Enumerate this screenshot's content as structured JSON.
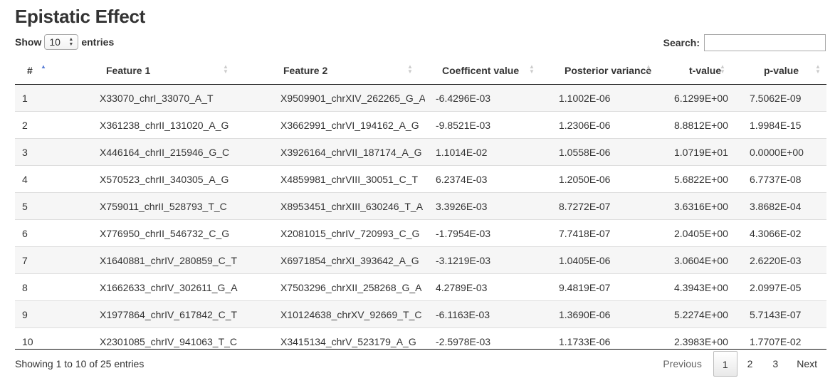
{
  "title": "Epistatic Effect",
  "length": {
    "show_label": "Show",
    "value": "10",
    "entries_label": "entries"
  },
  "search": {
    "label": "Search:",
    "value": ""
  },
  "columns": [
    "#",
    "Feature 1",
    "Feature 2",
    "Coefficent value",
    "Posterior variance",
    "t-value",
    "p-value"
  ],
  "sort": {
    "column": "#",
    "direction": "ascending"
  },
  "rows": [
    [
      "1",
      "X33070_chrI_33070_A_T",
      "X9509901_chrXIV_262265_G_A",
      "-6.4296E-03",
      "1.1002E-06",
      "6.1299E+00",
      "7.5062E-09"
    ],
    [
      "2",
      "X361238_chrII_131020_A_G",
      "X3662991_chrVI_194162_A_G",
      "-9.8521E-03",
      "1.2306E-06",
      "8.8812E+00",
      "1.9984E-15"
    ],
    [
      "3",
      "X446164_chrII_215946_G_C",
      "X3926164_chrVII_187174_A_G",
      "1.1014E-02",
      "1.0558E-06",
      "1.0719E+01",
      "0.0000E+00"
    ],
    [
      "4",
      "X570523_chrII_340305_A_G",
      "X4859981_chrVIII_30051_C_T",
      "6.2374E-03",
      "1.2050E-06",
      "5.6822E+00",
      "6.7737E-08"
    ],
    [
      "5",
      "X759011_chrII_528793_T_C",
      "X8953451_chrXIII_630246_T_A",
      "3.3926E-03",
      "8.7272E-07",
      "3.6316E+00",
      "3.8682E-04"
    ],
    [
      "6",
      "X776950_chrII_546732_C_G",
      "X2081015_chrIV_720993_C_G",
      "-1.7954E-03",
      "7.7418E-07",
      "2.0405E+00",
      "4.3066E-02"
    ],
    [
      "7",
      "X1640881_chrIV_280859_C_T",
      "X6971854_chrXI_393642_A_G",
      "-3.1219E-03",
      "1.0405E-06",
      "3.0604E+00",
      "2.6220E-03"
    ],
    [
      "8",
      "X1662633_chrIV_302611_G_A",
      "X7503296_chrXII_258268_G_A",
      "4.2789E-03",
      "9.4819E-07",
      "4.3943E+00",
      "2.0997E-05"
    ],
    [
      "9",
      "X1977864_chrIV_617842_C_T",
      "X10124638_chrXV_92669_T_C",
      "-6.1163E-03",
      "1.3690E-06",
      "5.2274E+00",
      "5.7143E-07"
    ],
    [
      "10",
      "X2301085_chrIV_941063_T_C",
      "X3415134_chrV_523179_A_G",
      "-2.5978E-03",
      "1.1733E-06",
      "2.3983E+00",
      "1.7707E-02"
    ]
  ],
  "info": "Showing 1 to 10 of 25 entries",
  "pagination": {
    "previous": "Previous",
    "pages": [
      "1",
      "2",
      "3"
    ],
    "current": "1",
    "next": "Next"
  },
  "colors": {
    "sort_active": "#5b7fd6",
    "stripe": "#f6f6f6",
    "border": "#111111"
  }
}
